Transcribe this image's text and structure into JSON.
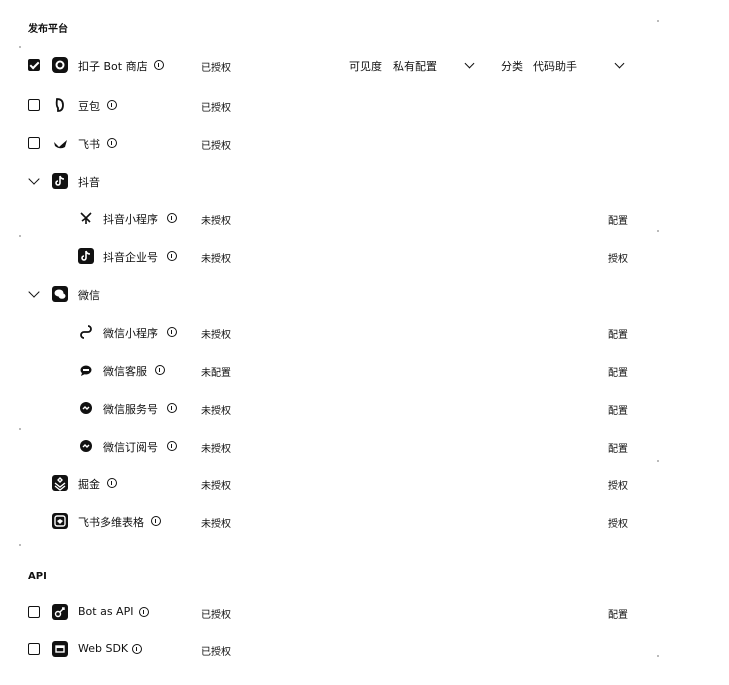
{
  "sections": {
    "publish_title": "发布平台",
    "api_title": "API"
  },
  "rows": {
    "koozi": {
      "name": "扣子 Bot 商店",
      "status": "已授权",
      "checked": true,
      "visibility_label": "可见度",
      "visibility_value": "私有配置",
      "category_label": "分类",
      "category_value": "代码助手"
    },
    "doubao": {
      "name": "豆包",
      "status": "已授权",
      "checked": false
    },
    "feishu": {
      "name": "飞书",
      "status": "已授权",
      "checked": false
    },
    "douyin": {
      "name": "抖音"
    },
    "douyin_mini": {
      "name": "抖音小程序",
      "status": "未授权",
      "action": "配置"
    },
    "douyin_biz": {
      "name": "抖音企业号",
      "status": "未授权",
      "action": "授权"
    },
    "wechat": {
      "name": "微信"
    },
    "wechat_mini": {
      "name": "微信小程序",
      "status": "未授权",
      "action": "配置"
    },
    "wechat_cs": {
      "name": "微信客服",
      "status": "未配置",
      "action": "配置"
    },
    "wechat_service": {
      "name": "微信服务号",
      "status": "未授权",
      "action": "配置"
    },
    "wechat_sub": {
      "name": "微信订阅号",
      "status": "未授权",
      "action": "配置"
    },
    "juejin": {
      "name": "掘金",
      "status": "未授权",
      "action": "授权"
    },
    "feishu_sheet": {
      "name": "飞书多维表格",
      "status": "未授权",
      "action": "授权"
    },
    "bot_api": {
      "name": "Bot as API",
      "status": "已授权",
      "action": "配置",
      "checked": false
    },
    "web_sdk": {
      "name": "Web SDK",
      "status": "已授权",
      "checked": false
    }
  },
  "icons": {
    "koozi": "coze-store-icon",
    "doubao": "doubao-icon",
    "feishu": "feishu-icon",
    "douyin": "douyin-icon",
    "douyin_mini": "douyin-miniapp-icon",
    "douyin_biz": "douyin-enterprise-icon",
    "wechat": "wechat-icon",
    "wechat_mini": "wechat-miniprogram-icon",
    "wechat_cs": "wechat-customer-service-icon",
    "wechat_service": "wechat-service-account-icon",
    "wechat_sub": "wechat-subscription-icon",
    "juejin": "juejin-icon",
    "feishu_sheet": "feishu-bitable-icon",
    "bot_api": "api-icon",
    "web_sdk": "web-sdk-icon"
  }
}
